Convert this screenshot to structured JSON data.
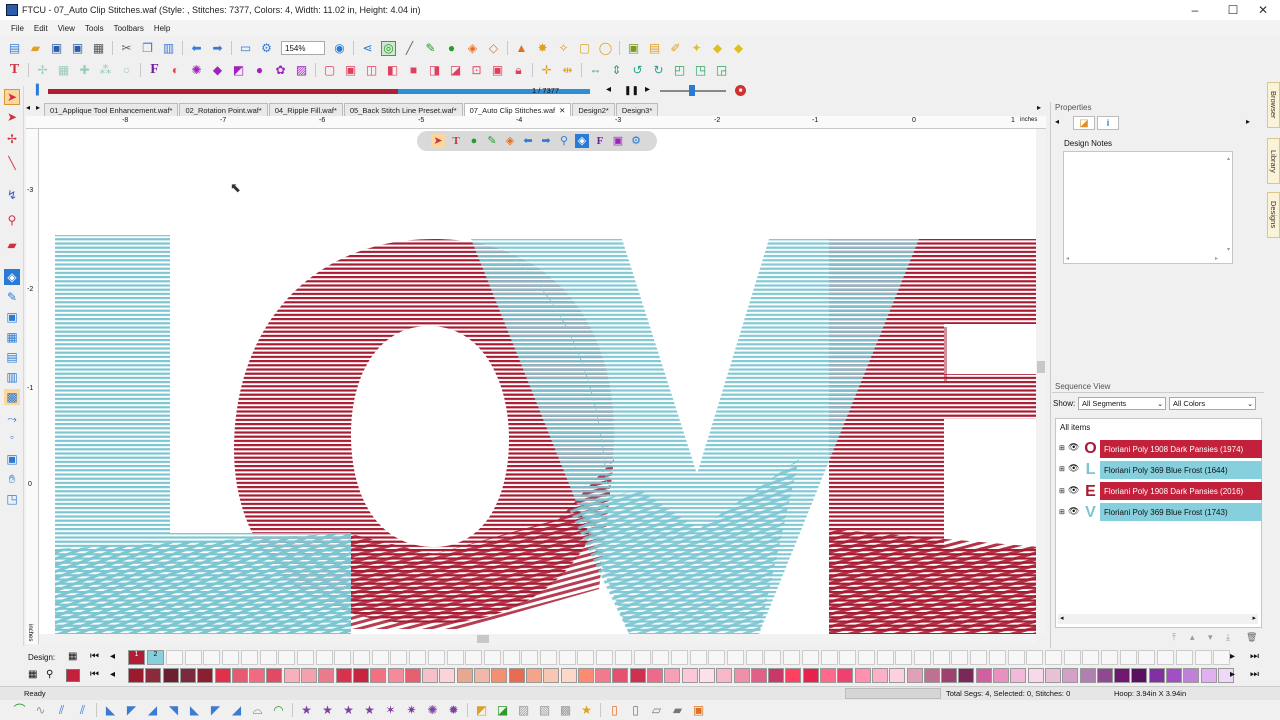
{
  "window": {
    "title": "FTCU - 07_Auto Clip Stitches.waf (Style: , Stitches: 7377, Colors: 4, Width: 11.02 in, Height: 4.04 in)",
    "controls": [
      "–",
      "☐",
      "✕"
    ]
  },
  "menu": [
    "File",
    "Edit",
    "View",
    "Tools",
    "Toolbars",
    "Help"
  ],
  "toolbar": {
    "zoom_value": "154%"
  },
  "playback": {
    "position": "1 / 7377",
    "progress": 0.53
  },
  "tabs": [
    {
      "label": "01_Applique Tool Enhancement.waf*",
      "active": false
    },
    {
      "label": "02_Rotation Point.waf*",
      "active": false
    },
    {
      "label": "04_Ripple Fill.waf*",
      "active": false
    },
    {
      "label": "05_Back Stitch Line Preset.waf*",
      "active": false
    },
    {
      "label": "07_Auto Clip Stitches.waf",
      "active": true
    },
    {
      "label": "Design2*",
      "active": false
    },
    {
      "label": "Design3*",
      "active": false
    }
  ],
  "ruler": {
    "top_labels": [
      "-8",
      "-7",
      "-6",
      "-5",
      "-4",
      "-3",
      "-2",
      "-1",
      "0",
      "1"
    ],
    "top_unit": "inches",
    "left_labels": [
      "-3",
      "-2",
      "-1",
      "0"
    ],
    "left_unit": "inches"
  },
  "design": {
    "letters": [
      "L",
      "O",
      "V",
      "E"
    ],
    "colors": {
      "red": "#a81c33",
      "blue": "#7cc6d2"
    }
  },
  "properties": {
    "title": "Properties",
    "design_notes_label": "Design Notes"
  },
  "sequence": {
    "title": "Sequence View",
    "show_label": "Show:",
    "segments_filter": "All Segments",
    "colors_filter": "All Colors",
    "all_items_label": "All items",
    "items": [
      {
        "letter": "O",
        "label": "Floriani Poly 1908 Dark Pansies (1974)",
        "color": "#c2203b",
        "text_color": "#ffffff"
      },
      {
        "letter": "L",
        "label": "Floriani Poly 369 Blue Frost (1644)",
        "color": "#86d0dd",
        "text_color": "#111111"
      },
      {
        "letter": "E",
        "label": "Floriani Poly 1908 Dark Pansies (2016)",
        "color": "#c2203b",
        "text_color": "#ffffff"
      },
      {
        "letter": "V",
        "label": "Floriani Poly 369 Blue Frost (1743)",
        "color": "#86d0dd",
        "text_color": "#111111"
      }
    ]
  },
  "side_tabs": [
    "Browser",
    "Library",
    "Designs"
  ],
  "design_bar": {
    "label": "Design:",
    "swatches": [
      {
        "label": "1",
        "color": "#b01e35"
      },
      {
        "label": "2",
        "color": "#86d0dd"
      }
    ]
  },
  "palette": [
    "#9c1a2e",
    "#8a2a3a",
    "#6a2030",
    "#7a2a3c",
    "#8a1f30",
    "#e0304a",
    "#e85a70",
    "#f06a80",
    "#e24a62",
    "#f7b0bc",
    "#f4a0ae",
    "#ea7a8c",
    "#d8324c",
    "#c8243e",
    "#f27080",
    "#f58a9a",
    "#e86070",
    "#f7c0c8",
    "#fbd4da",
    "#e8a890",
    "#f0b8a8",
    "#f49070",
    "#e86a50",
    "#f4a48a",
    "#f8c6b2",
    "#fcd8c8",
    "#ff8a70",
    "#f27a8c",
    "#e85070",
    "#d03050",
    "#ec6a8a",
    "#f8a0b8",
    "#fcc8d8",
    "#fde0e8",
    "#f6b8c8",
    "#f090a8",
    "#e06088",
    "#c83868",
    "#ff4060",
    "#e8204a",
    "#ff6a8a",
    "#f04070",
    "#ff90b0",
    "#fbb0c8",
    "#fdd0e0",
    "#e0a0b8",
    "#c07090",
    "#a04070",
    "#7a2858",
    "#d060a0",
    "#e890c0",
    "#f4b8d8",
    "#fad8ec",
    "#e8c0d8",
    "#d4a0c8",
    "#b080b0",
    "#904890",
    "#701870",
    "#5a1060",
    "#8030a0",
    "#a050c0",
    "#c080d8",
    "#e0b0f0",
    "#f0d8f8"
  ],
  "status": {
    "left": "Ready",
    "center": "Total Segs: 4, Selected: 0, Stitches: 0",
    "right": "Hoop: 3.94in X 3.94in"
  }
}
